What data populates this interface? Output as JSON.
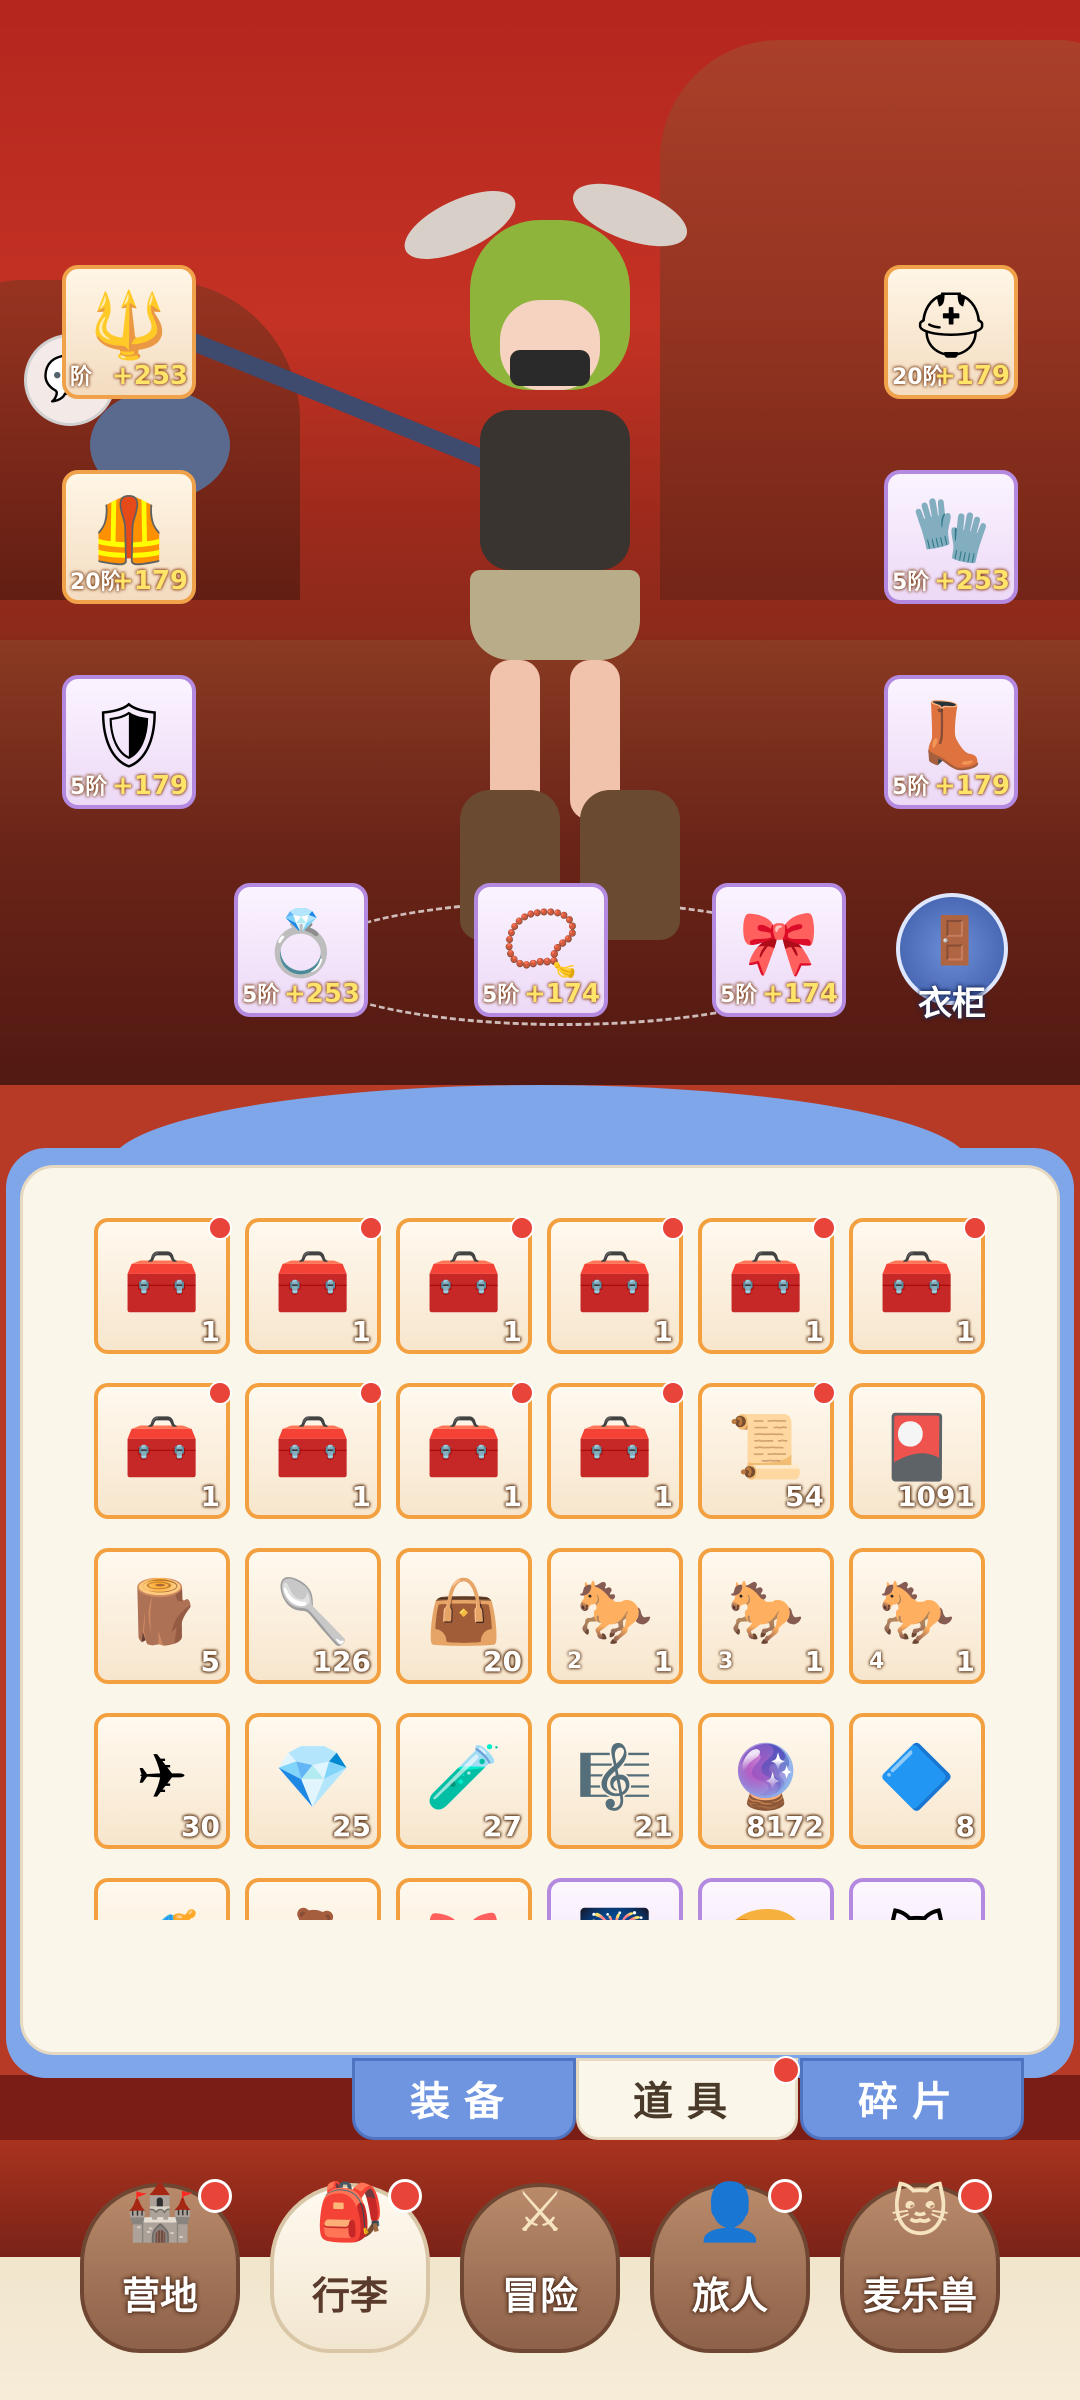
{
  "equipment": {
    "left": [
      {
        "icon": "spear-icon",
        "tier": "阶",
        "bonus": "+253",
        "glyph": "🔱",
        "rarity": "orange"
      },
      {
        "icon": "armor-icon",
        "tier": "20阶",
        "bonus": "+179",
        "glyph": "🦺",
        "rarity": "orange"
      },
      {
        "icon": "pauldron-icon",
        "tier": "5阶",
        "bonus": "+179",
        "glyph": "🛡",
        "rarity": "purple"
      }
    ],
    "right": [
      {
        "icon": "helmet-icon",
        "tier": "20阶",
        "bonus": "+179",
        "glyph": "⛑",
        "rarity": "orange"
      },
      {
        "icon": "gauntlet-icon",
        "tier": "5阶",
        "bonus": "+253",
        "glyph": "🧤",
        "rarity": "purple"
      },
      {
        "icon": "boots-icon",
        "tier": "5阶",
        "bonus": "+179",
        "glyph": "👢",
        "rarity": "purple"
      }
    ],
    "bottom": [
      {
        "icon": "ring-icon",
        "tier": "5阶",
        "bonus": "+253",
        "glyph": "💍",
        "rarity": "purple"
      },
      {
        "icon": "necklace-icon",
        "tier": "5阶",
        "bonus": "+174",
        "glyph": "📿",
        "rarity": "purple"
      },
      {
        "icon": "amulet-icon",
        "tier": "5阶",
        "bonus": "+174",
        "glyph": "🎀",
        "rarity": "purple"
      }
    ]
  },
  "wardrobe": {
    "label": "衣柜",
    "icon": "wardrobe-icon"
  },
  "chat": {
    "icon": "chat-bubble-icon"
  },
  "inventory": [
    {
      "icon": "chest-icon",
      "glyph": "🧰",
      "count": "1",
      "badge": true,
      "rarity": "orange"
    },
    {
      "icon": "chest-icon",
      "glyph": "🧰",
      "count": "1",
      "badge": true,
      "rarity": "orange"
    },
    {
      "icon": "chest-icon",
      "glyph": "🧰",
      "count": "1",
      "badge": true,
      "rarity": "orange"
    },
    {
      "icon": "chest-icon",
      "glyph": "🧰",
      "count": "1",
      "badge": true,
      "rarity": "orange"
    },
    {
      "icon": "chest-icon",
      "glyph": "🧰",
      "count": "1",
      "badge": true,
      "rarity": "orange"
    },
    {
      "icon": "chest-icon",
      "glyph": "🧰",
      "count": "1",
      "badge": true,
      "rarity": "orange"
    },
    {
      "icon": "chest-icon",
      "glyph": "🧰",
      "count": "1",
      "badge": true,
      "rarity": "orange"
    },
    {
      "icon": "chest-icon",
      "glyph": "🧰",
      "count": "1",
      "badge": true,
      "rarity": "orange"
    },
    {
      "icon": "chest-icon",
      "glyph": "🧰",
      "count": "1",
      "badge": true,
      "rarity": "orange"
    },
    {
      "icon": "chest-icon",
      "glyph": "🧰",
      "count": "1",
      "badge": true,
      "rarity": "orange"
    },
    {
      "icon": "scroll-icon",
      "glyph": "📜",
      "count": "54",
      "badge": true,
      "rarity": "orange"
    },
    {
      "icon": "card-icon",
      "glyph": "🎴",
      "count": "1091",
      "badge": false,
      "rarity": "orange"
    },
    {
      "icon": "log-icon",
      "glyph": "🪵",
      "count": "5",
      "badge": false,
      "rarity": "orange"
    },
    {
      "icon": "spoon-icon",
      "glyph": "🥄",
      "count": "126",
      "badge": false,
      "rarity": "orange"
    },
    {
      "icon": "seed-bag-icon",
      "glyph": "👜",
      "count": "20",
      "badge": false,
      "rarity": "orange"
    },
    {
      "icon": "saddle-icon",
      "glyph": "🐎",
      "count": "1",
      "level": "2",
      "badge": false,
      "rarity": "orange"
    },
    {
      "icon": "saddle-icon",
      "glyph": "🐎",
      "count": "1",
      "level": "3",
      "badge": false,
      "rarity": "orange"
    },
    {
      "icon": "saddle-icon",
      "glyph": "🐎",
      "count": "1",
      "level": "4",
      "badge": false,
      "rarity": "orange"
    },
    {
      "icon": "paper-plane-icon",
      "glyph": "✈",
      "count": "30",
      "badge": false,
      "rarity": "orange"
    },
    {
      "icon": "amber-gem-icon",
      "glyph": "💎",
      "count": "25",
      "badge": false,
      "rarity": "orange"
    },
    {
      "icon": "potion-icon",
      "glyph": "🧪",
      "count": "27",
      "badge": false,
      "rarity": "orange"
    },
    {
      "icon": "lyre-icon",
      "glyph": "🎼",
      "count": "21",
      "badge": false,
      "rarity": "orange"
    },
    {
      "icon": "orb-icon",
      "glyph": "🔮",
      "count": "8172",
      "badge": false,
      "rarity": "orange"
    },
    {
      "icon": "crystal-icon",
      "glyph": "🔷",
      "count": "8",
      "badge": false,
      "rarity": "orange"
    },
    {
      "icon": "bottle-icon",
      "glyph": "🍼",
      "count": "",
      "badge": false,
      "rarity": "orange"
    },
    {
      "icon": "toy-icon",
      "glyph": "🧸",
      "count": "",
      "badge": false,
      "rarity": "orange"
    },
    {
      "icon": "ribbon-icon",
      "glyph": "🎀",
      "count": "",
      "badge": false,
      "rarity": "orange"
    },
    {
      "icon": "firework-icon",
      "glyph": "🎆",
      "count": "",
      "badge": false,
      "rarity": "purple"
    },
    {
      "icon": "bread-icon",
      "glyph": "🍞",
      "count": "",
      "badge": false,
      "rarity": "purple"
    },
    {
      "icon": "pet-icon",
      "glyph": "🐱",
      "count": "",
      "badge": false,
      "rarity": "purple"
    }
  ],
  "tabs": [
    {
      "label": "装备",
      "active": false
    },
    {
      "label": "道具",
      "active": true,
      "badge": true
    },
    {
      "label": "碎片",
      "active": false
    }
  ],
  "nav": [
    {
      "label": "营地",
      "icon": "castle-icon",
      "glyph": "🏰",
      "active": false,
      "badge": true
    },
    {
      "label": "行李",
      "icon": "backpack-icon",
      "glyph": "🎒",
      "active": true,
      "badge": true
    },
    {
      "label": "冒险",
      "icon": "crossed-swords-icon",
      "glyph": "⚔",
      "active": false,
      "badge": false
    },
    {
      "label": "旅人",
      "icon": "traveler-icon",
      "glyph": "👤",
      "active": false,
      "badge": true
    },
    {
      "label": "麦乐兽",
      "icon": "pet-face-icon",
      "glyph": "🐱",
      "active": false,
      "badge": true
    }
  ]
}
